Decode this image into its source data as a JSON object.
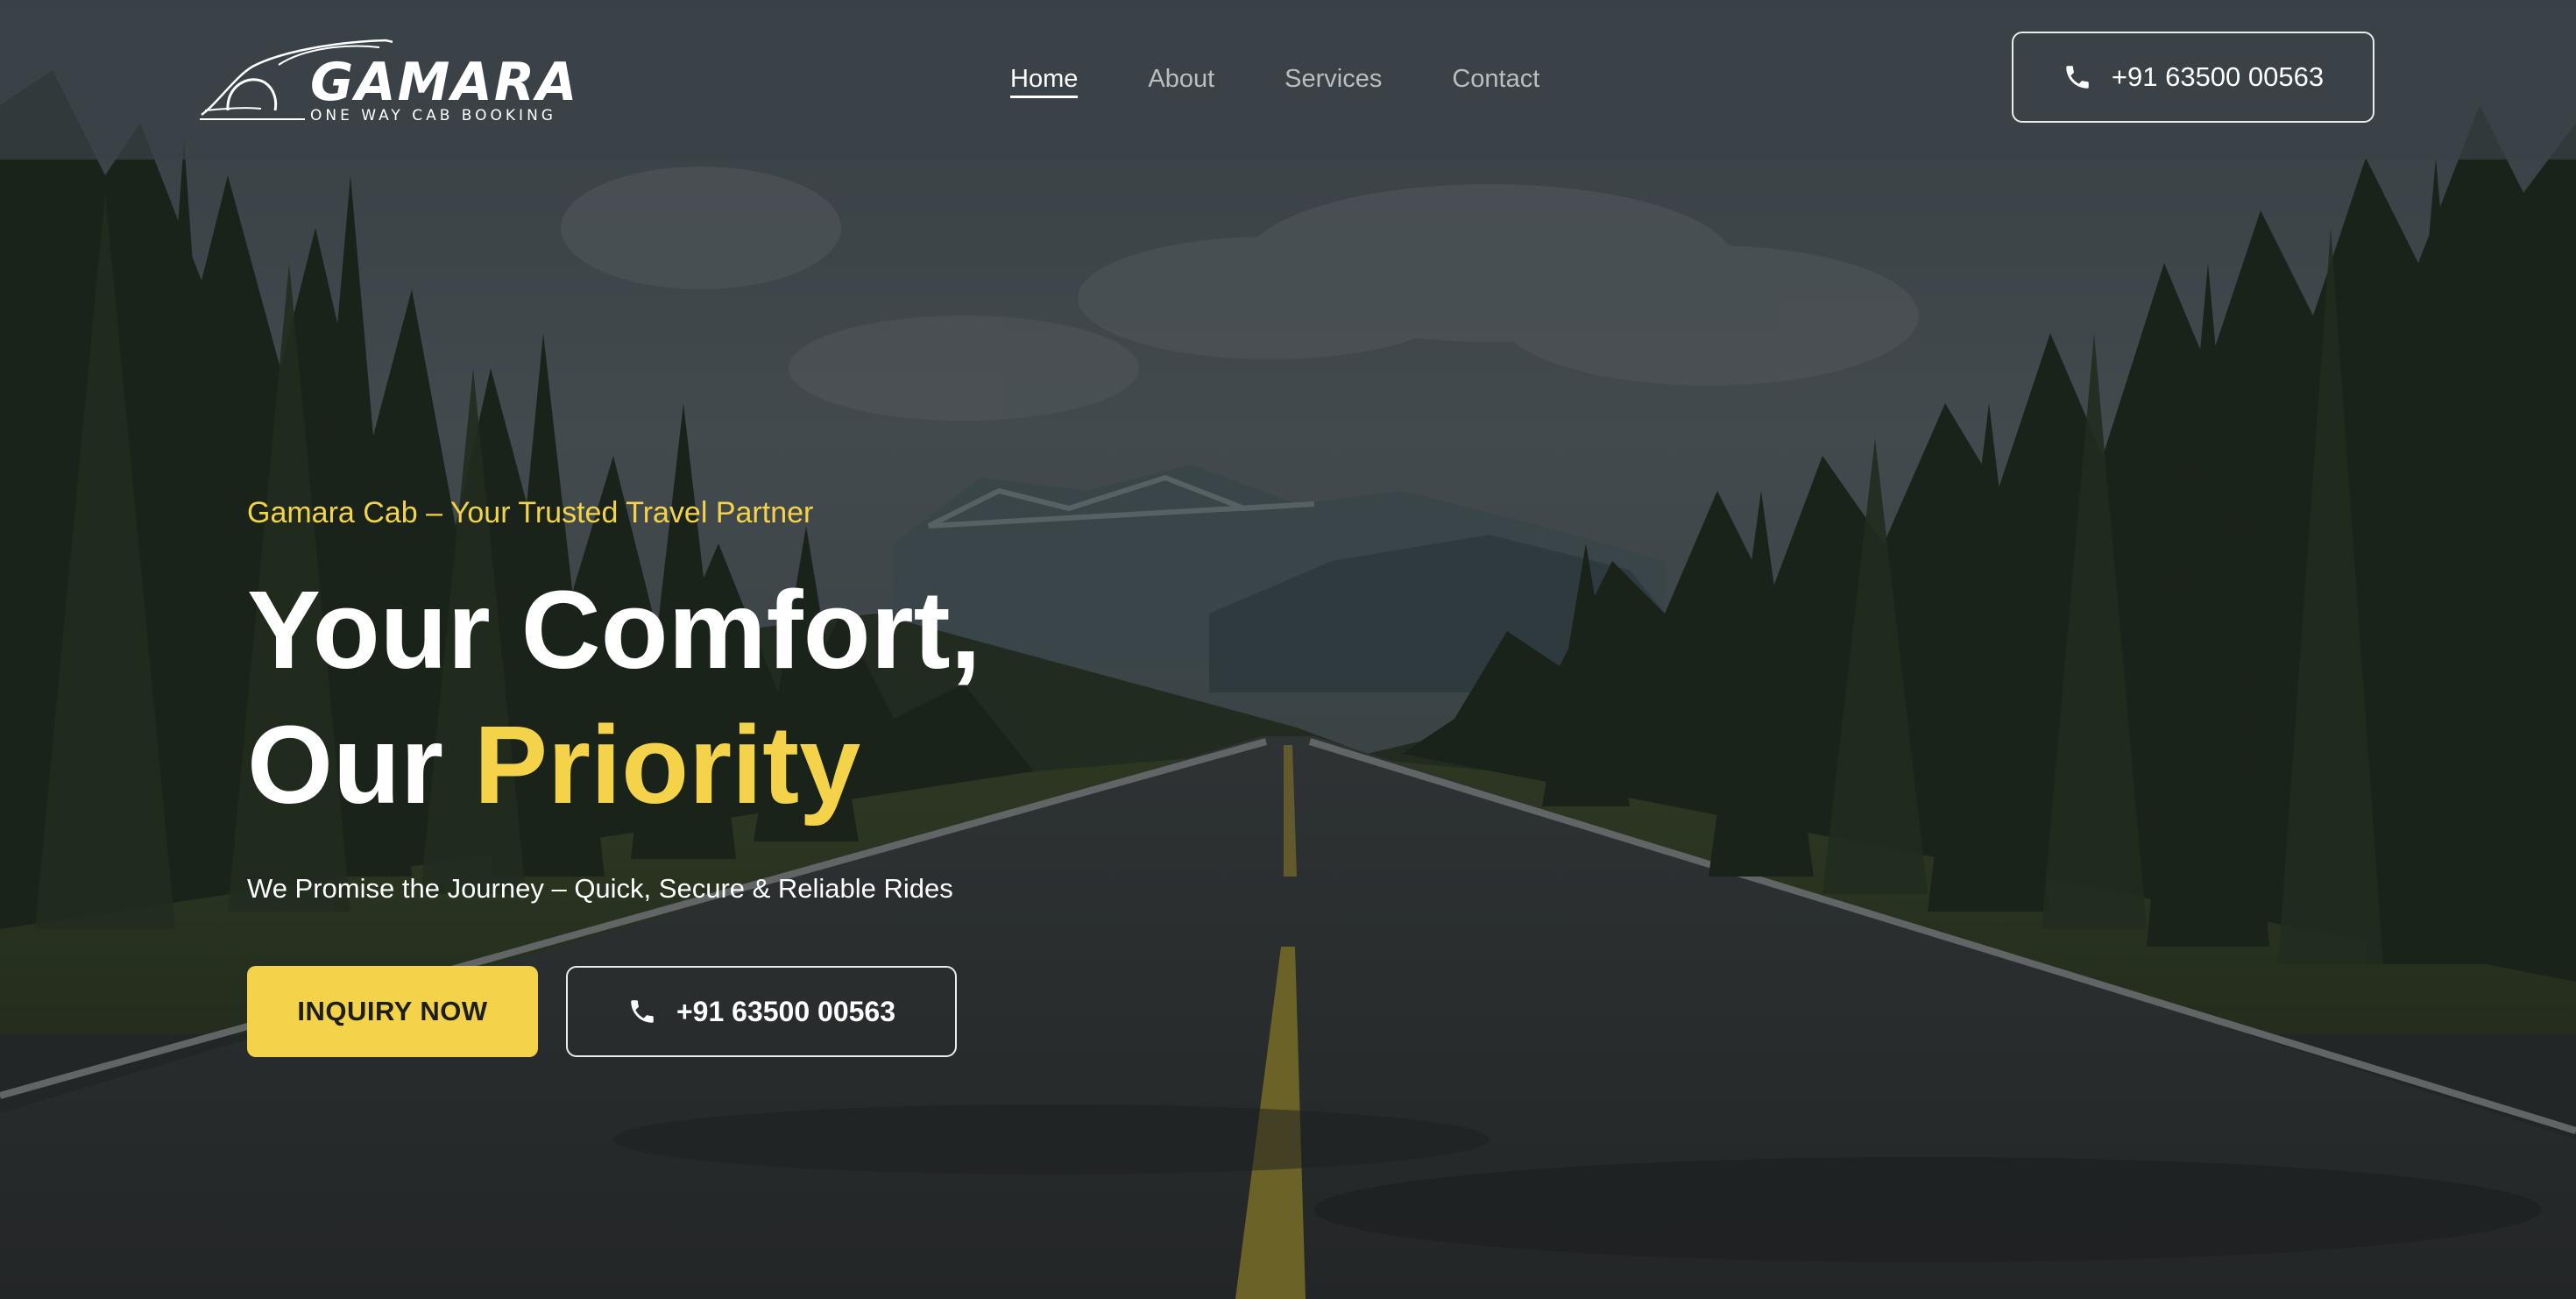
{
  "brand": {
    "name": "GAMARA",
    "tagline": "ONE WAY CAB BOOKING",
    "logo_icon": "car-outline-icon",
    "accent_color": "#f4d34a"
  },
  "nav": {
    "items": [
      {
        "label": "Home",
        "active": true
      },
      {
        "label": "About",
        "active": false
      },
      {
        "label": "Services",
        "active": false
      },
      {
        "label": "Contact",
        "active": false
      }
    ]
  },
  "header": {
    "phone_label": "+91 63500 00563",
    "phone_icon": "phone-icon"
  },
  "hero": {
    "kicker": "Gamara Cab – Your Trusted Travel Partner",
    "title_line1": "Your Comfort,",
    "title_line2_prefix": "Our ",
    "title_line2_accent": "Priority",
    "subtitle": "We Promise the Journey – Quick, Secure & Reliable Rides",
    "cta_primary": "INQUIRY NOW",
    "cta_phone": "+91 63500 00563"
  }
}
